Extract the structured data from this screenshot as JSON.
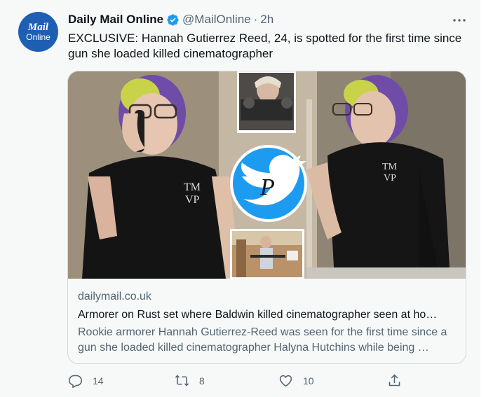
{
  "tweet": {
    "avatar": {
      "line1": "Mail",
      "line2": "Online"
    },
    "display_name": "Daily Mail Online",
    "verified_icon": "verified-badge-icon",
    "handle": "@MailOnline",
    "separator": "·",
    "time": "2h",
    "more_icon": "more-options-icon",
    "text": "EXCLUSIVE: Hannah Gutierrez Reed, 24, is spotted for the first time since gun she loaded killed cinematographer"
  },
  "card": {
    "domain": "dailymail.co.uk",
    "title": "Armorer on Rust set where Baldwin killed cinematographer seen at ho…",
    "description": "Rookie armorer Hannah Gutierrez-Reed was seen for the first time since a gun she loaded killed cinematographer Halyna Hutchins while being …",
    "image_badge_letter": "P",
    "shirt_text_line1": "TM",
    "shirt_text_line2": "VP"
  },
  "actions": {
    "reply": {
      "icon": "reply-icon",
      "count": "14"
    },
    "retweet": {
      "icon": "retweet-icon",
      "count": "8"
    },
    "like": {
      "icon": "like-heart-icon",
      "count": "10"
    },
    "share": {
      "icon": "share-icon"
    }
  },
  "colors": {
    "brand_blue": "#1d9bf0",
    "avatar_blue": "#1e5fb4",
    "secondary_text": "#536471",
    "card_border": "#cfd9de"
  }
}
